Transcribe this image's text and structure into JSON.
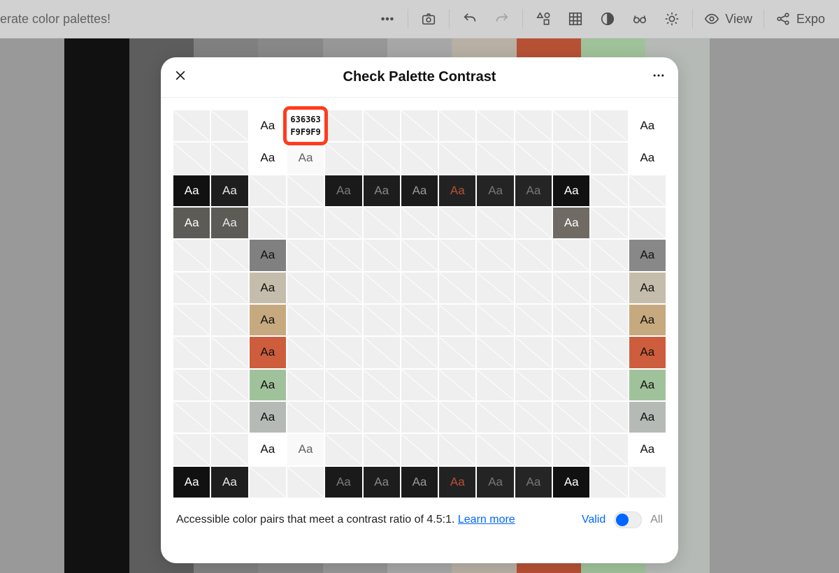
{
  "topbar": {
    "left_text": "enerate color palettes!",
    "view_label": "View",
    "export_label": "Expo"
  },
  "palette_stripes": [
    "#999999",
    "#111111",
    "#5d5d5d",
    "#808080",
    "#888888",
    "#979797",
    "#a7a7a7",
    "#b8b0a4",
    "#b75135",
    "#a0c29b",
    "#b5bab6",
    "#999999",
    "#999999"
  ],
  "modal": {
    "title": "Check Palette Contrast",
    "aa": "Aa",
    "tooltip_fg": "636363",
    "tooltip_bg": "F9F9F9",
    "footer_text": "Accessible color pairs that meet a contrast ratio of 4.5:1.",
    "learn_more": "Learn more",
    "valid_label": "Valid",
    "all_label": "All"
  },
  "palette_colors": [
    "#111111",
    "#1e1e1e",
    "#ffffff",
    "#f9f9f9",
    "#1a1a1a",
    "#1d1d1d",
    "#1b1b1b",
    "#222222",
    "#242424",
    "#252525",
    "#262626",
    "#6f6a63",
    "#ffffff"
  ],
  "text_for_col_light": [
    "#ffffff",
    "#e6e6e6",
    "#111111",
    "#636363",
    "#7a7a7a",
    "#888888",
    "#999999",
    "#b75135",
    "#777777",
    "#777777",
    "#ffffff",
    "#ffffff",
    "#111111"
  ],
  "grid": [
    [
      null,
      null,
      {
        "bg": "#ffffff",
        "fg": "#111111"
      },
      {
        "bg": "#f9f9f9",
        "fg": "#636363"
      },
      null,
      null,
      null,
      null,
      null,
      null,
      null,
      null,
      {
        "bg": "#ffffff",
        "fg": "#111111"
      }
    ],
    [
      null,
      null,
      {
        "bg": "#ffffff",
        "fg": "#111111"
      },
      {
        "bg": "#f9f9f9",
        "fg": "#636363"
      },
      null,
      null,
      null,
      null,
      null,
      null,
      null,
      null,
      {
        "bg": "#ffffff",
        "fg": "#111111"
      }
    ],
    [
      {
        "bg": "#111111",
        "fg": "#ffffff"
      },
      {
        "bg": "#1e1e1e",
        "fg": "#e6e6e6"
      },
      null,
      null,
      {
        "bg": "#1a1a1a",
        "fg": "#7a7a7a"
      },
      {
        "bg": "#1d1d1d",
        "fg": "#888888"
      },
      {
        "bg": "#1b1b1b",
        "fg": "#999999"
      },
      {
        "bg": "#222222",
        "fg": "#b75135"
      },
      {
        "bg": "#242424",
        "fg": "#777777"
      },
      {
        "bg": "#252525",
        "fg": "#777777"
      },
      {
        "bg": "#111111",
        "fg": "#ffffff"
      },
      null,
      null
    ],
    [
      {
        "bg": "#5d5b55",
        "fg": "#ffffff"
      },
      {
        "bg": "#5d5b55",
        "fg": "#e6e6e6"
      },
      null,
      null,
      null,
      null,
      null,
      null,
      null,
      null,
      {
        "bg": "#6f6a63",
        "fg": "#ffffff"
      },
      null,
      null
    ],
    [
      null,
      null,
      {
        "bg": "#808080",
        "fg": "#111111"
      },
      null,
      null,
      null,
      null,
      null,
      null,
      null,
      null,
      null,
      {
        "bg": "#888888",
        "fg": "#111111"
      }
    ],
    [
      null,
      null,
      {
        "bg": "#c5bdab",
        "fg": "#111111"
      },
      null,
      null,
      null,
      null,
      null,
      null,
      null,
      null,
      null,
      {
        "bg": "#c5bdab",
        "fg": "#111111"
      }
    ],
    [
      null,
      null,
      {
        "bg": "#c7a97f",
        "fg": "#111111"
      },
      null,
      null,
      null,
      null,
      null,
      null,
      null,
      null,
      null,
      {
        "bg": "#c7a97f",
        "fg": "#111111"
      }
    ],
    [
      null,
      null,
      {
        "bg": "#cd5d3d",
        "fg": "#111111"
      },
      null,
      null,
      null,
      null,
      null,
      null,
      null,
      null,
      null,
      {
        "bg": "#cd5d3d",
        "fg": "#111111"
      }
    ],
    [
      null,
      null,
      {
        "bg": "#a0c29b",
        "fg": "#111111"
      },
      null,
      null,
      null,
      null,
      null,
      null,
      null,
      null,
      null,
      {
        "bg": "#a0c29b",
        "fg": "#111111"
      }
    ],
    [
      null,
      null,
      {
        "bg": "#b5bab6",
        "fg": "#111111"
      },
      null,
      null,
      null,
      null,
      null,
      null,
      null,
      null,
      null,
      {
        "bg": "#b5bab6",
        "fg": "#111111"
      }
    ],
    [
      null,
      null,
      {
        "bg": "#ffffff",
        "fg": "#111111"
      },
      {
        "bg": "#f9f9f9",
        "fg": "#636363"
      },
      null,
      null,
      null,
      null,
      null,
      null,
      null,
      null,
      {
        "bg": "#ffffff",
        "fg": "#111111"
      }
    ],
    [
      {
        "bg": "#111111",
        "fg": "#ffffff"
      },
      {
        "bg": "#1e1e1e",
        "fg": "#e6e6e6"
      },
      null,
      null,
      {
        "bg": "#1a1a1a",
        "fg": "#7a7a7a"
      },
      {
        "bg": "#1d1d1d",
        "fg": "#888888"
      },
      {
        "bg": "#1b1b1b",
        "fg": "#999999"
      },
      {
        "bg": "#222222",
        "fg": "#b75135"
      },
      {
        "bg": "#242424",
        "fg": "#777777"
      },
      {
        "bg": "#252525",
        "fg": "#777777"
      },
      {
        "bg": "#111111",
        "fg": "#ffffff"
      },
      null,
      null
    ]
  ]
}
